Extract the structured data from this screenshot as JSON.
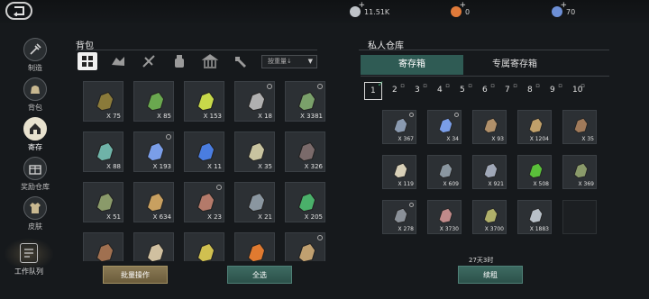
{
  "currencies": [
    {
      "name": "silver-coin-icon",
      "value": "11.51K",
      "color": "#bfc3c8"
    },
    {
      "name": "gold-coin-icon",
      "value": "0",
      "color": "#e07a3a"
    },
    {
      "name": "diamond-icon",
      "value": "70",
      "color": "#6d8fd6"
    }
  ],
  "nav": [
    {
      "label": "制造",
      "icon": "crafting-icon",
      "active": false
    },
    {
      "label": "背包",
      "icon": "bag-icon",
      "active": false
    },
    {
      "label": "寄存",
      "icon": "storage-house-icon",
      "active": true
    },
    {
      "label": "奖励仓库",
      "icon": "reward-warehouse-icon",
      "active": false
    },
    {
      "label": "皮肤",
      "icon": "skin-icon",
      "active": false
    }
  ],
  "nav_bottom": {
    "label": "工作队列",
    "icon": "work-queue-icon"
  },
  "bag": {
    "title": "背包",
    "sort_label": "按重量↓",
    "filters": [
      "all-items-icon",
      "materials-icon",
      "weapons-icon",
      "consumables-icon",
      "buildings-icon",
      "tools-icon"
    ],
    "items": [
      {
        "icon": "crossbow-item",
        "qty": "X 75",
        "locked": false,
        "color": "#8a7a3a"
      },
      {
        "icon": "green-potion-item",
        "qty": "X 85",
        "locked": false,
        "color": "#6aa84f"
      },
      {
        "icon": "sulfur-ore-item",
        "qty": "X 153",
        "locked": false,
        "color": "#c7d94a"
      },
      {
        "icon": "iron-ring-item",
        "qty": "X 18",
        "locked": true,
        "color": "#b0b0b0"
      },
      {
        "icon": "green-shield-item",
        "qty": "X 3381",
        "locked": true,
        "color": "#7aa06a"
      },
      {
        "icon": "crystal-ore-item",
        "qty": "X 88",
        "locked": false,
        "color": "#6fb3a8"
      },
      {
        "icon": "blue-gem-item",
        "qty": "X 193",
        "locked": true,
        "color": "#7a9ee8"
      },
      {
        "icon": "blue-crystal-item",
        "qty": "X 11",
        "locked": false,
        "color": "#4a7de0"
      },
      {
        "icon": "stone-chunk-item",
        "qty": "X 35",
        "locked": false,
        "color": "#c9c4a0"
      },
      {
        "icon": "dark-shard-item",
        "qty": "X 326",
        "locked": false,
        "color": "#7a6a6a"
      },
      {
        "icon": "shield-emblem-item",
        "qty": "X 51",
        "locked": false,
        "color": "#8a9a6a"
      },
      {
        "icon": "spear-item",
        "qty": "X 634",
        "locked": false,
        "color": "#c8a060"
      },
      {
        "icon": "meat-item",
        "qty": "X 23",
        "locked": true,
        "color": "#b47a6a"
      },
      {
        "icon": "grey-rock-item",
        "qty": "X 21",
        "locked": false,
        "color": "#8a96a0"
      },
      {
        "icon": "green-orb-item",
        "qty": "X 205",
        "locked": false,
        "color": "#4ab06a"
      },
      {
        "icon": "wood-logs-item",
        "qty": "",
        "locked": false,
        "color": "#a07050"
      },
      {
        "icon": "arrow-item",
        "qty": "",
        "locked": false,
        "color": "#d0c0a0"
      },
      {
        "icon": "yellow-pile-item",
        "qty": "",
        "locked": false,
        "color": "#d0c050"
      },
      {
        "icon": "orange-gel-item",
        "qty": "",
        "locked": false,
        "color": "#e07a30"
      },
      {
        "icon": "brass-part-item",
        "qty": "",
        "locked": true,
        "color": "#c0a070"
      }
    ],
    "batch_button": "批量操作",
    "select_all_button": "全选"
  },
  "storage": {
    "title": "私人仓库",
    "tabs": [
      {
        "label": "寄存箱",
        "active": true
      },
      {
        "label": "专属寄存箱",
        "active": false
      }
    ],
    "pages": [
      "1",
      "2",
      "3",
      "4",
      "5",
      "6",
      "7",
      "8",
      "9",
      "10"
    ],
    "active_page": "1",
    "items": [
      {
        "icon": "gear-cluster-item",
        "qty": "X 367",
        "locked": true,
        "color": "#8a9ab0"
      },
      {
        "icon": "blue-gem-item",
        "qty": "X 34",
        "locked": true,
        "color": "#7a9ee8"
      },
      {
        "icon": "leather-scrap-item",
        "qty": "X 93",
        "locked": false,
        "color": "#b0906a"
      },
      {
        "icon": "copper-ore-item",
        "qty": "X 1204",
        "locked": false,
        "color": "#c0a06a"
      },
      {
        "icon": "bound-book-item",
        "qty": "X 35",
        "locked": false,
        "color": "#a07a5a"
      },
      {
        "icon": "bone-item",
        "qty": "X 119",
        "locked": false,
        "color": "#d8d0b8"
      },
      {
        "icon": "grey-stone-item",
        "qty": "X 609",
        "locked": false,
        "color": "#8a96a0"
      },
      {
        "icon": "silver-ore-item",
        "qty": "X 921",
        "locked": false,
        "color": "#a0a8b8"
      },
      {
        "icon": "green-flame-item",
        "qty": "X 508",
        "locked": false,
        "color": "#5ac03a"
      },
      {
        "icon": "round-shield-item",
        "qty": "X 369",
        "locked": false,
        "color": "#8a9a6a"
      },
      {
        "icon": "armor-plate-item",
        "qty": "X 278",
        "locked": true,
        "color": "#8a9098"
      },
      {
        "icon": "pink-meat-item",
        "qty": "X 3730",
        "locked": false,
        "color": "#c08a8a"
      },
      {
        "icon": "herb-bundle-item",
        "qty": "X 3700",
        "locked": false,
        "color": "#b0b06a"
      },
      {
        "icon": "silver-ingot-item",
        "qty": "X 1883",
        "locked": false,
        "color": "#b8c0c8"
      }
    ],
    "timer": "27天3时",
    "rent_button": "续租"
  }
}
